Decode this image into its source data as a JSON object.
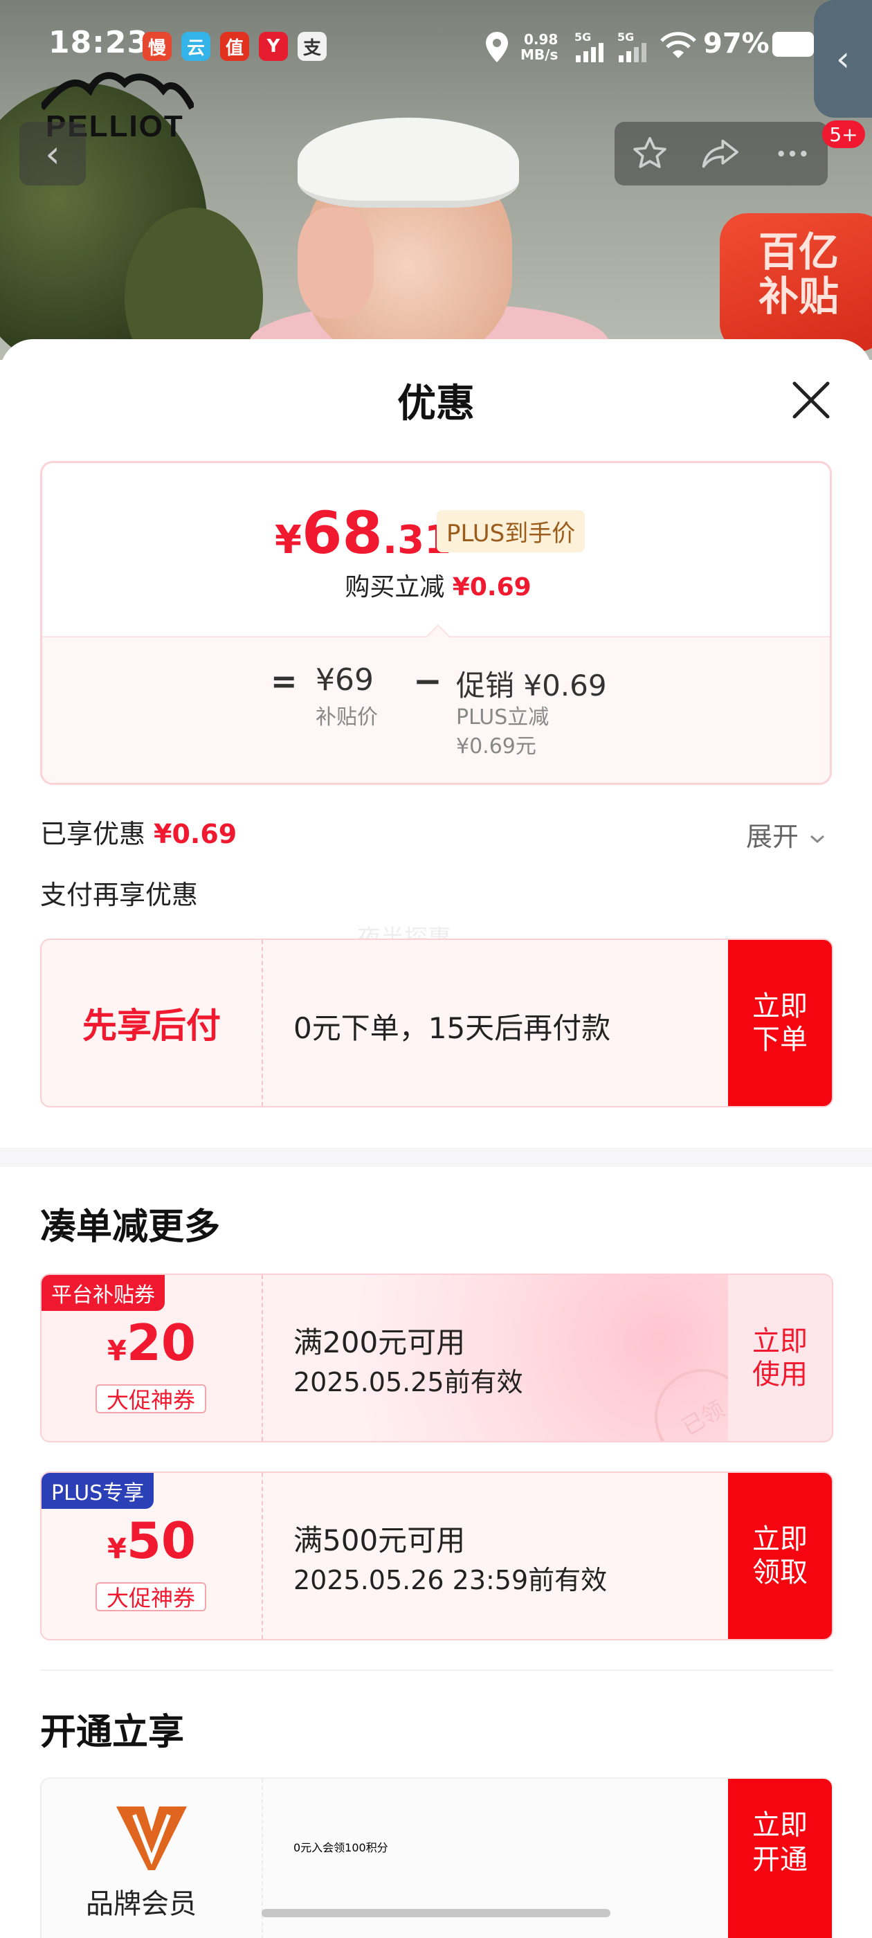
{
  "status_bar": {
    "time": "18:23",
    "net_speed": "0.98",
    "net_unit": "MB/s",
    "sig1": "5G",
    "sig2": "5G",
    "battery": "97%",
    "app_icons": [
      "慢",
      "云",
      "值",
      "Y",
      "支"
    ]
  },
  "brand": {
    "logo_text": "PELLIOT"
  },
  "badge": "5+",
  "subsidy_badge": {
    "line1": "百亿",
    "line2": "补贴"
  },
  "sheet": {
    "title": "优惠"
  },
  "price": {
    "currency": "¥",
    "integer": "68",
    "decimal": ".31",
    "plus_tag": "PLUS到手价",
    "reduce_label": "购买立减",
    "reduce_value": "¥0.69",
    "equals": "=",
    "base_price": "¥69",
    "base_label": "补贴价",
    "minus": "−",
    "promo": "促销 ¥0.69",
    "promo_sub1": "PLUS立减",
    "promo_sub2": "¥0.69元"
  },
  "enjoyed": {
    "label": "已享优惠",
    "value": "¥0.69",
    "expand": "展开"
  },
  "pay_section": {
    "title": "支付再享优惠",
    "watermark": "夜半探惠"
  },
  "pay_later": {
    "name": "先享后付",
    "desc": "0元下单，15天后再付款",
    "cta": "立即下单"
  },
  "bundle_section": {
    "title": "凑单减更多"
  },
  "coupons": [
    {
      "tag": "平台补贴券",
      "currency": "¥",
      "amount": "20",
      "badge": "大促神券",
      "condition": "满200元可用",
      "validity": "2025.05.25前有效",
      "cta": "立即使用",
      "stamp": "已领"
    },
    {
      "tag": "PLUS专享",
      "currency": "¥",
      "amount": "50",
      "badge": "大促神券",
      "condition": "满500元可用",
      "validity": "2025.05.26 23:59前有效",
      "cta": "立即领取"
    }
  ],
  "membership_section": {
    "title": "开通立享"
  },
  "membership": {
    "label": "品牌会员",
    "desc": "0元入会领100积分",
    "cta": "立即开通"
  },
  "colors": {
    "accent": "#f1192f",
    "cta_red": "#f5050f",
    "plus_tag_bg": "#fdf1da",
    "plus_blue": "#2b3fb7"
  }
}
